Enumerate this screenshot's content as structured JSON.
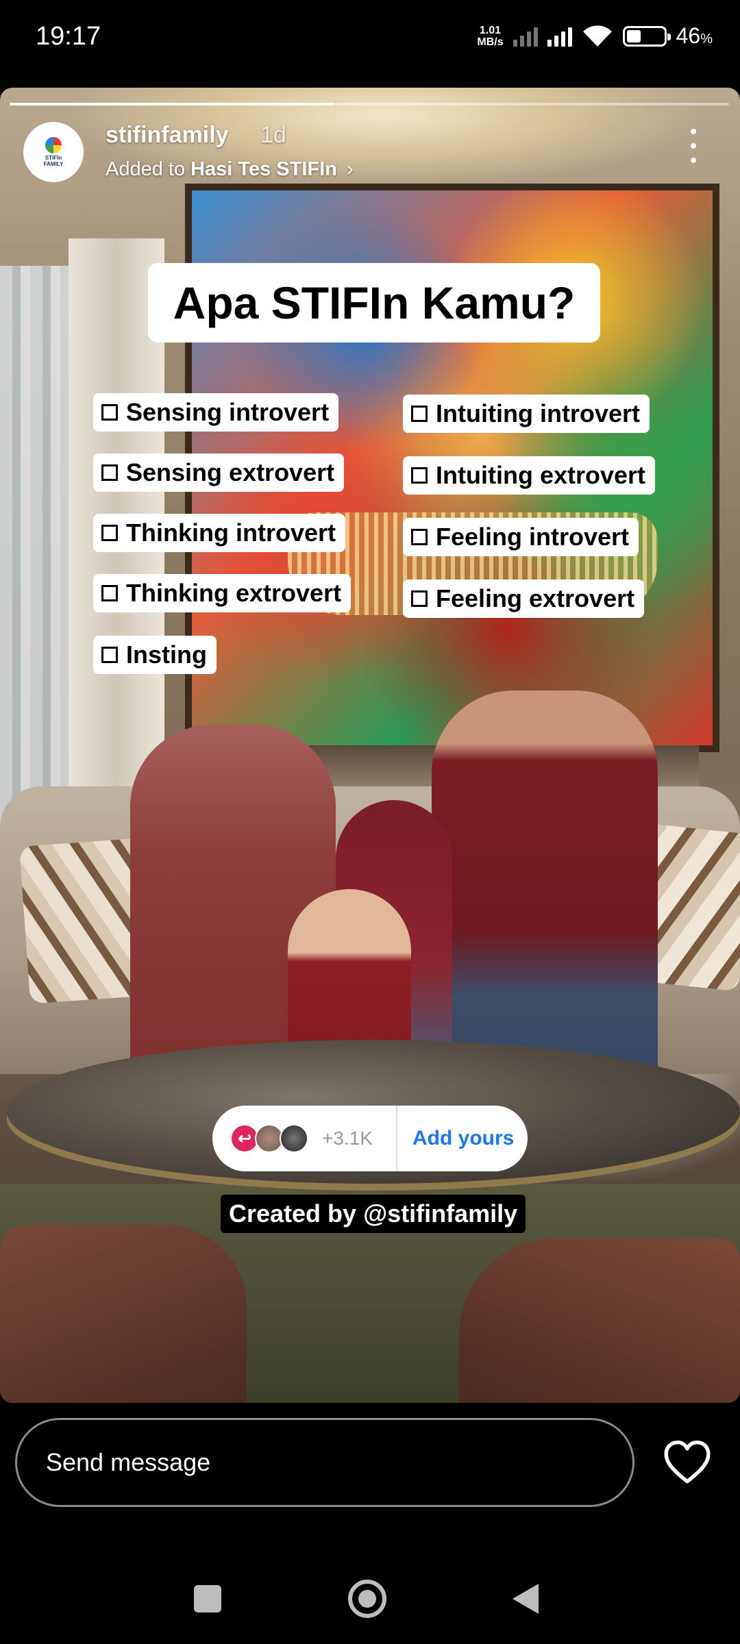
{
  "status_bar": {
    "time": "19:17",
    "net_speed_value": "1.01",
    "net_speed_unit": "MB/s",
    "battery_percent": "46",
    "battery_unit": "%",
    "battery_level": 0.46
  },
  "story": {
    "progress": 0.45,
    "username": "stifinfamily",
    "time_ago": "1d",
    "added_to_prefix": "Added to",
    "highlight_name": "Hasi Tes STIFIn",
    "avatar_text_line1": "STIFIn",
    "avatar_text_line2": "FAMILY",
    "headline": "Apa STIFIn Kamu?",
    "options": [
      "Sensing introvert",
      "Sensing extrovert",
      "Thinking introvert",
      "Thinking extrovert",
      "Insting",
      "Intuiting introvert",
      "Intuiting extrovert",
      "Feeling introvert",
      "Feeling extrovert"
    ],
    "add_yours": {
      "count": "+3.1K",
      "label": "Add yours",
      "reply_icon": "↩"
    },
    "created_by": "Created by @stifinfamily"
  },
  "bottom": {
    "message_placeholder": "Send message"
  },
  "colors": {
    "add_yours_accent": "#1877f2",
    "reply_badge": "#e0245e"
  }
}
